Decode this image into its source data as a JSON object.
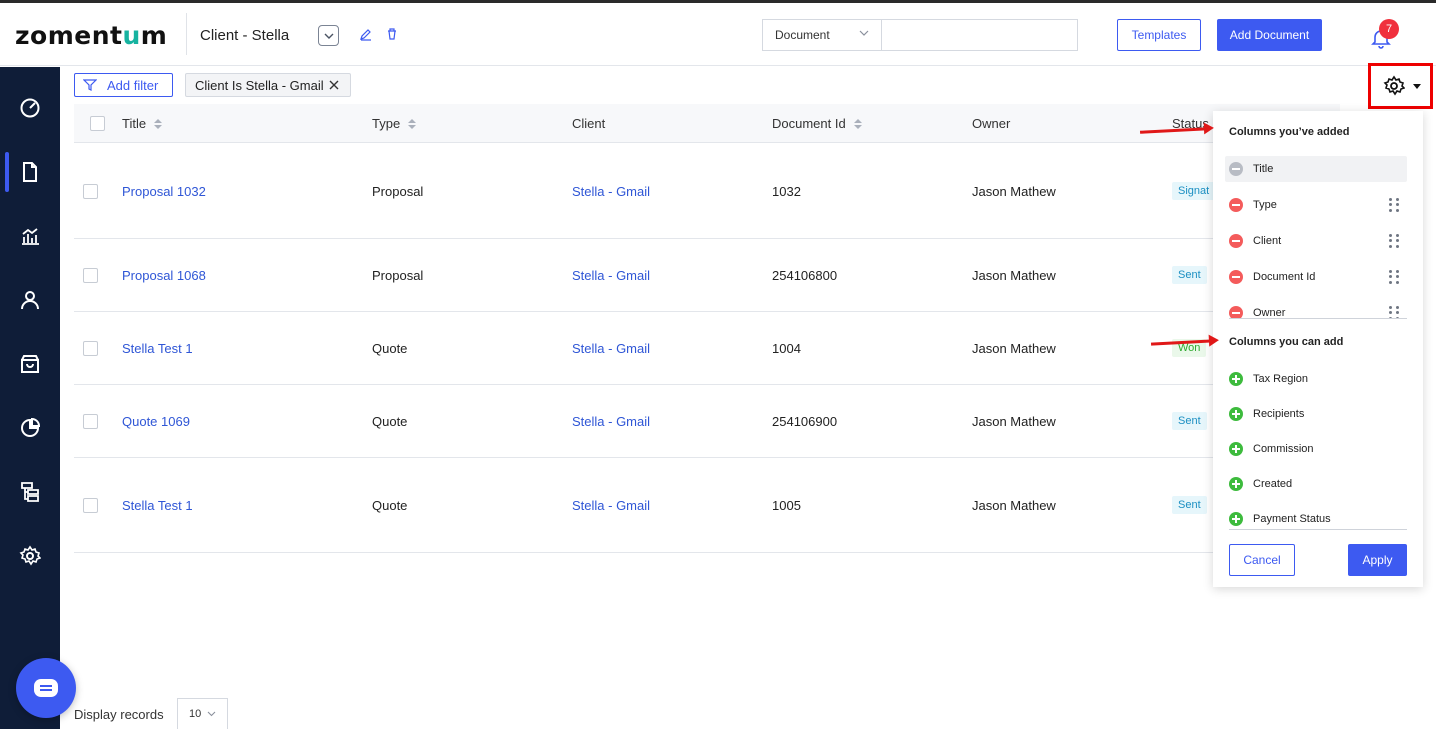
{
  "brand": {
    "logo_a": "zoment",
    "logo_b": "u",
    "logo_c": "m",
    "accent": "#16b3a0"
  },
  "header": {
    "client_title": "Client - Stella",
    "doc_type_select": "Document",
    "search_value": "",
    "templates_label": "Templates",
    "add_document_label": "Add Document",
    "notification_count": "7"
  },
  "sidebar": {
    "items": [
      "dashboard-icon",
      "documents-icon",
      "reports-icon",
      "clients-icon",
      "products-icon",
      "analytics-icon",
      "hierarchy-icon",
      "settings-icon"
    ],
    "active": "documents-icon"
  },
  "filters": {
    "add_filter_label": "Add filter",
    "chip_label": "Client Is Stella - Gmail"
  },
  "table": {
    "columns": [
      "Title",
      "Type",
      "Client",
      "Document Id",
      "Owner",
      "Status"
    ],
    "rows": [
      {
        "title": "Proposal 1032",
        "type": "Proposal",
        "client": "Stella - Gmail",
        "document_id": "1032",
        "owner": "Jason Mathew",
        "status": "Signat"
      },
      {
        "title": "Proposal 1068",
        "type": "Proposal",
        "client": "Stella - Gmail",
        "document_id": "254106800",
        "owner": "Jason Mathew",
        "status": "Sent"
      },
      {
        "title": "Stella Test 1",
        "type": "Quote",
        "client": "Stella - Gmail",
        "document_id": "1004",
        "owner": "Jason Mathew",
        "status": "Won"
      },
      {
        "title": "Quote 1069",
        "type": "Quote",
        "client": "Stella - Gmail",
        "document_id": "254106900",
        "owner": "Jason Mathew",
        "status": "Sent"
      },
      {
        "title": "Stella Test 1",
        "type": "Quote",
        "client": "Stella - Gmail",
        "document_id": "1005",
        "owner": "Jason Mathew",
        "status": "Sent"
      }
    ]
  },
  "column_panel": {
    "added_heading": "Columns you’ve added",
    "added": [
      "Title",
      "Type",
      "Client",
      "Document Id",
      "Owner"
    ],
    "can_add_heading": "Columns you can add",
    "can_add": [
      "Tax Region",
      "Recipients",
      "Commission",
      "Created",
      "Payment Status"
    ],
    "cancel_label": "Cancel",
    "apply_label": "Apply"
  },
  "footer": {
    "display_records_label": "Display records",
    "records_per_page": "10"
  }
}
